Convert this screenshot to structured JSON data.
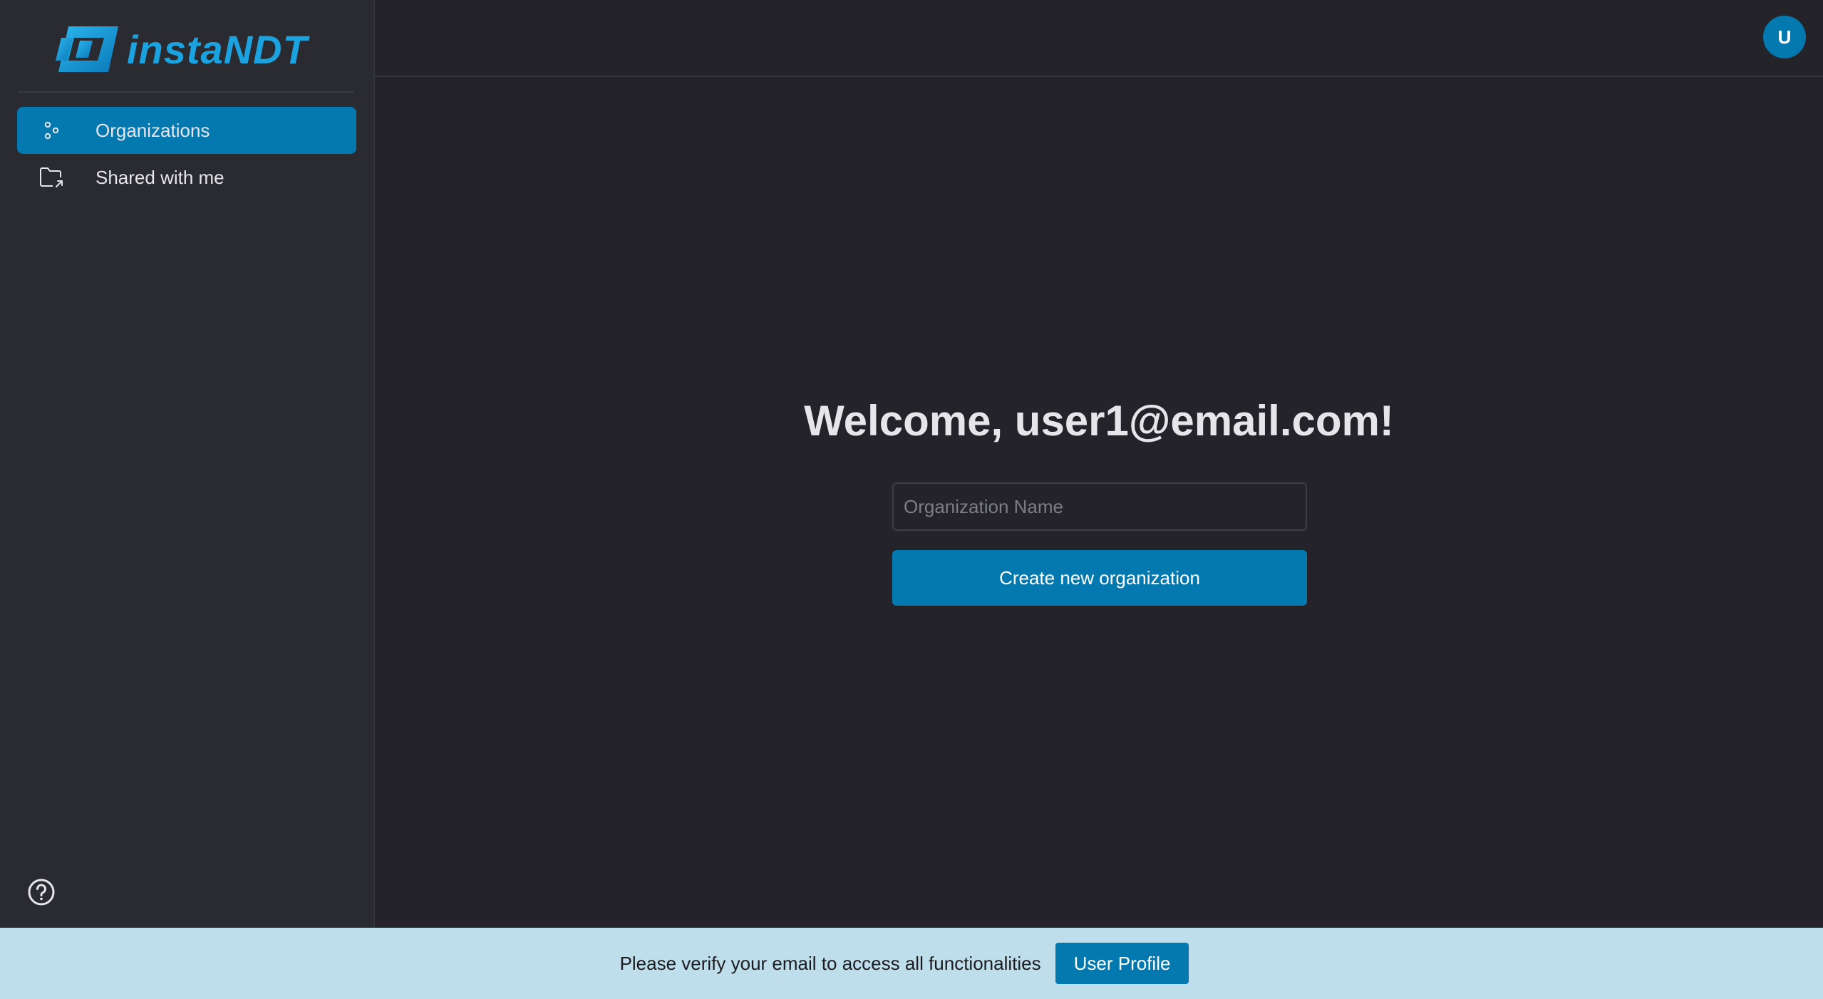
{
  "brand": {
    "name": "instaNDT",
    "color": "#1aa3de"
  },
  "sidebar": {
    "items": [
      {
        "label": "Organizations",
        "icon": "organizations-icon",
        "active": true
      },
      {
        "label": "Shared with me",
        "icon": "folder-share-icon",
        "active": false
      }
    ],
    "help_icon": "help-icon"
  },
  "header": {
    "avatar_initial": "U"
  },
  "main": {
    "welcome": "Welcome, user1@email.com!",
    "org_input": {
      "placeholder": "Organization Name",
      "value": ""
    },
    "create_button": "Create new organization"
  },
  "banner": {
    "message": "Please verify your email to access all functionalities",
    "button_label": "User Profile"
  },
  "colors": {
    "accent": "#0479b0",
    "background": "#232329",
    "sidebar": "#2a2a31",
    "banner": "#bddeea"
  }
}
